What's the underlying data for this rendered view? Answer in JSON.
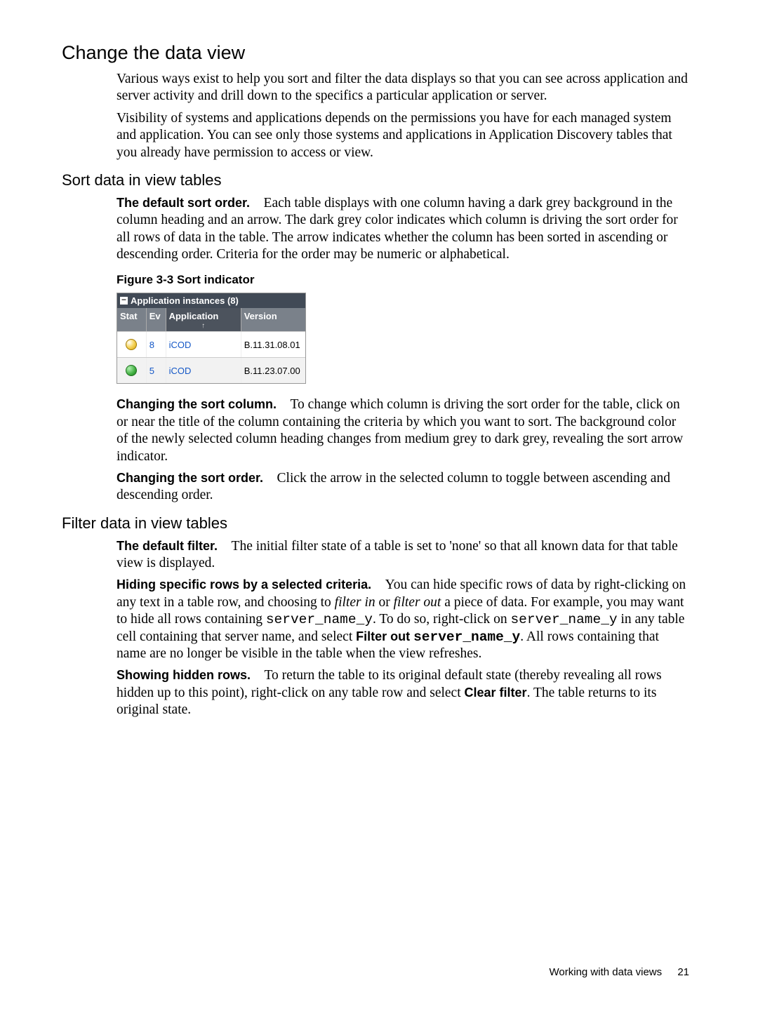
{
  "h1": "Change the data view",
  "p1": "Various ways exist to help you sort and filter the data displays so that you can see across application and server activity and drill down to the specifics a particular application or server.",
  "p2": "Visibility of systems and applications depends on the permissions you have for each managed system and application. You can see only those systems and applications in Application Discovery tables that you already have permission to access or view.",
  "h2a": "Sort data in view tables",
  "sort": {
    "lead1": "The default sort order.",
    "body1": "Each table displays with one column having a dark grey background in the column heading and an arrow. The dark grey color indicates which column is driving the sort order for all rows of data in the table. The arrow indicates whether the column has been sorted in ascending or descending order. Criteria for the order may be numeric or alphabetical.",
    "figcap": "Figure 3-3 Sort indicator",
    "lead2": "Changing the sort column.",
    "body2": "To change which column is driving the sort order for the table, click on or near the title of the column containing the criteria by which you want to sort. The background color of the newly selected column heading changes from medium grey to dark grey, revealing the sort arrow indicator.",
    "lead3": "Changing the sort order.",
    "body3": "Click the arrow in the selected column to toggle between ascending and descending order."
  },
  "fig": {
    "title": "Application instances (8)",
    "collapse_glyph": "−",
    "head": {
      "stat": "Stat",
      "ev": "Ev",
      "app": "Application",
      "ver": "Version"
    },
    "arrow": "↑",
    "rows": [
      {
        "ev": "8",
        "app": "iCOD",
        "ver": "B.11.31.08.01",
        "status": "minor"
      },
      {
        "ev": "5",
        "app": "iCOD",
        "ver": "B.11.23.07.00",
        "status": "normal"
      }
    ]
  },
  "h2b": "Filter data in view tables",
  "filter": {
    "lead1": "The default filter.",
    "body1": "The initial filter state of a table is set to 'none' so that all known data for that table view is displayed.",
    "lead2": "Hiding specific rows by a selected criteria.",
    "body2a": "You can hide specific rows of data by right-clicking on any text in a table row, and choosing to ",
    "body2_i1": "filter in",
    "body2b": " or ",
    "body2_i2": "filter out",
    "body2c": " a piece of data. For example, you may want to hide all rows containing ",
    "body2_m1": "server_name_y",
    "body2d": ". To do so, right-click on ",
    "body2_m2": "server_name_y",
    "body2e": " in any table cell containing that server name, and select ",
    "body2_bold": "Filter out ",
    "body2_mbold": "server_name_y",
    "body2f": ". All rows containing that name are no longer be visible in the table when the view refreshes.",
    "lead3": "Showing hidden rows.",
    "body3a": "To return the table to its original default state (thereby revealing all rows hidden up to this point), right-click on any table row and select ",
    "body3_bold": "Clear filter",
    "body3b": ". The table returns to its original state."
  },
  "footer": {
    "text": "Working with data views",
    "page": "21"
  }
}
